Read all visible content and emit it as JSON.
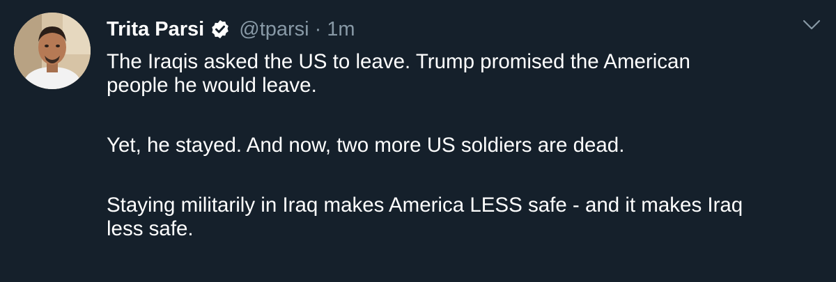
{
  "tweet": {
    "author_name": "Trita Parsi",
    "verified": true,
    "handle": "@tparsi",
    "separator": "·",
    "time": "1m",
    "paragraphs": [
      {
        "lines": [
          "The Iraqis asked the US to leave. Trump promised the American",
          "people he would leave."
        ]
      },
      {
        "lines": [
          "Yet, he stayed. And now, two more US soldiers are dead."
        ]
      },
      {
        "lines": [
          "Staying militarily in Iraq makes America LESS safe - and it makes Iraq",
          "less safe."
        ]
      }
    ]
  },
  "icons": {
    "avatar": "user-avatar",
    "verified": "verified-badge-icon",
    "menu": "chevron-down-icon"
  },
  "colors": {
    "background": "#15202b",
    "text_primary": "#ffffff",
    "text_secondary": "#8899a6",
    "verified_badge": "#ffffff",
    "verified_check": "#15202b"
  }
}
